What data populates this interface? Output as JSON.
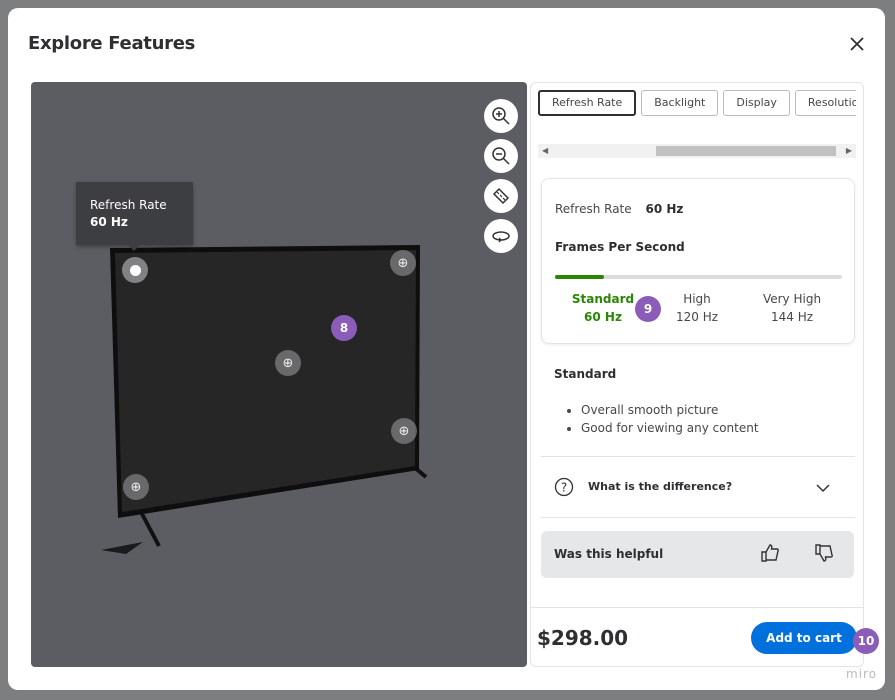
{
  "modal": {
    "title": "Explore Features"
  },
  "viewer": {
    "tooltip": {
      "label": "Refresh Rate",
      "value": "60 Hz"
    },
    "badge": "8"
  },
  "tabs": [
    {
      "label": "Refresh Rate",
      "active": true
    },
    {
      "label": "Backlight"
    },
    {
      "label": "Display"
    },
    {
      "label": "Resolution"
    }
  ],
  "card": {
    "label": "Refresh Rate",
    "value": "60 Hz",
    "heading": "Frames Per Second",
    "progress_percent": 17,
    "levels": [
      {
        "name": "Standard",
        "value": "60 Hz",
        "selected": true
      },
      {
        "name": "High",
        "value": "120 Hz"
      },
      {
        "name": "Very High",
        "value": "144 Hz"
      }
    ],
    "badge": "9"
  },
  "detail": {
    "heading": "Standard",
    "bullets": [
      "Overall smooth picture",
      "Good for viewing any content"
    ]
  },
  "faq": {
    "label": "What is the difference?"
  },
  "helpful": {
    "label": "Was this helpful"
  },
  "footer": {
    "price": "$298.00",
    "cart_label": "Add to cart",
    "badge": "10"
  },
  "watermark": "miro",
  "colors": {
    "accent": "#0071dc",
    "selected": "#2a8703",
    "badge": "#8c5db8"
  }
}
